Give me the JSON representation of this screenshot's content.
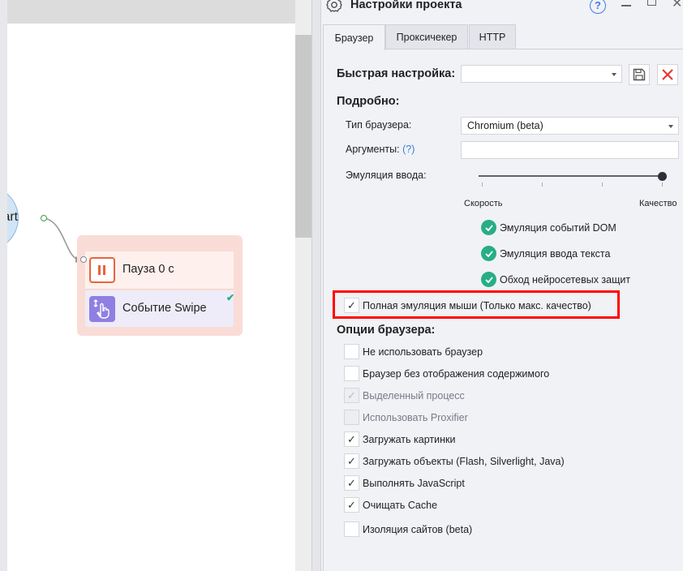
{
  "canvas": {
    "start_label": "tart",
    "node_group": [
      {
        "label": "Пауза 0 с",
        "icon": "pause-icon"
      },
      {
        "label": "Событие Swipe",
        "icon": "swipe-icon",
        "status": "check-icon"
      }
    ]
  },
  "dialog": {
    "title": "Настройки проекта",
    "help": "?",
    "tabs": [
      {
        "label": "Браузер",
        "active": true
      },
      {
        "label": "Проксичекер"
      },
      {
        "label": "HTTP"
      }
    ],
    "quick_setting": {
      "label": "Быстрая настройка:",
      "value": ""
    },
    "details_heading": "Подробно:",
    "browser_type": {
      "label": "Тип браузера:",
      "value": "Chromium (beta)"
    },
    "arguments": {
      "label": "Аргументы:",
      "help_link": "(?)",
      "value": ""
    },
    "input_emulation": {
      "label": "Эмуляция ввода:",
      "min_label": "Скорость",
      "max_label": "Качество",
      "level": 3,
      "max_level": 3
    },
    "emulation_features": [
      "Эмуляция событий DOM",
      "Эмуляция ввода текста",
      "Обход нейросетевых защит"
    ],
    "full_mouse": {
      "label": "Полная эмуляция мыши (Только макс. качество)",
      "checked": true
    },
    "browser_options_heading": "Опции браузера:",
    "browser_options": [
      {
        "label": "Не использовать браузер",
        "checked": false,
        "disabled": false
      },
      {
        "label": "Браузер без отображения содержимого",
        "checked": false,
        "disabled": false
      },
      {
        "label": "Выделенный процесс",
        "checked": true,
        "disabled": true
      },
      {
        "label": "Использовать Proxifier",
        "checked": false,
        "disabled": true
      },
      {
        "label": "Загружать картинки",
        "checked": true,
        "disabled": false
      },
      {
        "label": "Загружать объекты (Flash, Silverlight, Java)",
        "checked": true,
        "disabled": false
      },
      {
        "label": "Выполнять JavaScript",
        "checked": true,
        "disabled": false
      },
      {
        "label": "Очищать Cache",
        "checked": true,
        "disabled": false
      },
      {
        "label": "Изоляция сайтов (beta)",
        "checked": false,
        "disabled": false
      }
    ]
  },
  "colors": {
    "accent": "#27ae84",
    "highlight": "#ff0000",
    "pause": "#e8643c",
    "swipe": "#8f7fe2"
  }
}
